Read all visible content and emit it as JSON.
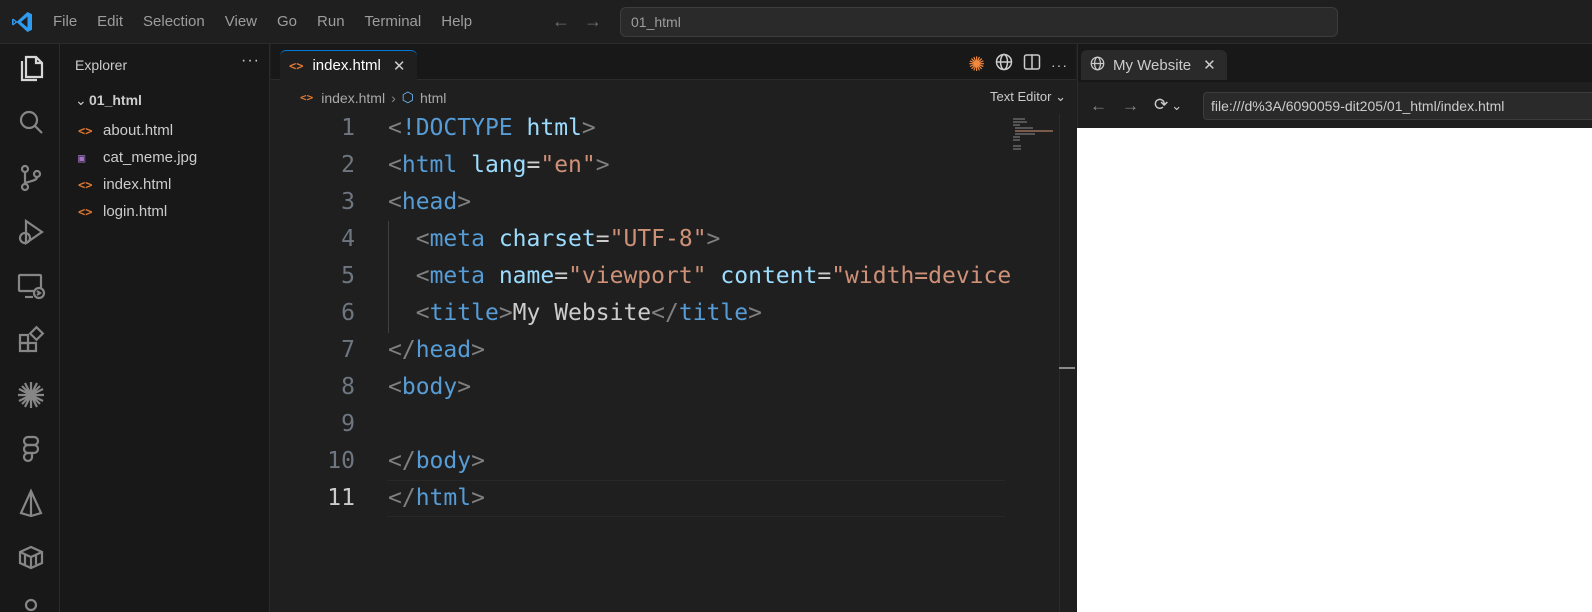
{
  "menu": [
    "File",
    "Edit",
    "Selection",
    "View",
    "Go",
    "Run",
    "Terminal",
    "Help"
  ],
  "command_center": "01_html",
  "activity_icons": [
    "explorer-icon",
    "search-icon",
    "source-control-icon",
    "run-debug-icon",
    "remote-explorer-icon",
    "extensions-icon",
    "sparkle-icon",
    "figma-icon",
    "prism-icon",
    "container-icon"
  ],
  "sidebar": {
    "title": "Explorer",
    "more": "···",
    "folder": "01_html",
    "files": [
      {
        "name": "about.html",
        "type": "html"
      },
      {
        "name": "cat_meme.jpg",
        "type": "image"
      },
      {
        "name": "index.html",
        "type": "html"
      },
      {
        "name": "login.html",
        "type": "html"
      }
    ]
  },
  "editor": {
    "tab_label": "index.html",
    "breadcrumb_file": "index.html",
    "breadcrumb_symbol": "html",
    "mode_label": "Text Editor",
    "current_line": 11,
    "lines": [
      [
        {
          "t": "br",
          "v": "<"
        },
        {
          "t": "tag",
          "v": "!DOCTYPE"
        },
        {
          "t": "txt",
          "v": " "
        },
        {
          "t": "attr",
          "v": "html"
        },
        {
          "t": "br",
          "v": ">"
        }
      ],
      [
        {
          "t": "br",
          "v": "<"
        },
        {
          "t": "tag",
          "v": "html"
        },
        {
          "t": "txt",
          "v": " "
        },
        {
          "t": "attr",
          "v": "lang"
        },
        {
          "t": "txt",
          "v": "="
        },
        {
          "t": "str",
          "v": "\"en\""
        },
        {
          "t": "br",
          "v": ">"
        }
      ],
      [
        {
          "t": "br",
          "v": "<"
        },
        {
          "t": "tag",
          "v": "head"
        },
        {
          "t": "br",
          "v": ">"
        }
      ],
      [
        {
          "t": "txt",
          "v": "  "
        },
        {
          "t": "br",
          "v": "<"
        },
        {
          "t": "tag",
          "v": "meta"
        },
        {
          "t": "txt",
          "v": " "
        },
        {
          "t": "attr",
          "v": "charset"
        },
        {
          "t": "txt",
          "v": "="
        },
        {
          "t": "str",
          "v": "\"UTF-8\""
        },
        {
          "t": "br",
          "v": ">"
        }
      ],
      [
        {
          "t": "txt",
          "v": "  "
        },
        {
          "t": "br",
          "v": "<"
        },
        {
          "t": "tag",
          "v": "meta"
        },
        {
          "t": "txt",
          "v": " "
        },
        {
          "t": "attr",
          "v": "name"
        },
        {
          "t": "txt",
          "v": "="
        },
        {
          "t": "str",
          "v": "\"viewport\""
        },
        {
          "t": "txt",
          "v": " "
        },
        {
          "t": "attr",
          "v": "content"
        },
        {
          "t": "txt",
          "v": "="
        },
        {
          "t": "str",
          "v": "\"width=device"
        }
      ],
      [
        {
          "t": "txt",
          "v": "  "
        },
        {
          "t": "br",
          "v": "<"
        },
        {
          "t": "tag",
          "v": "title"
        },
        {
          "t": "br",
          "v": ">"
        },
        {
          "t": "txt",
          "v": "My Website"
        },
        {
          "t": "br",
          "v": "</"
        },
        {
          "t": "tag",
          "v": "title"
        },
        {
          "t": "br",
          "v": ">"
        }
      ],
      [
        {
          "t": "br",
          "v": "</"
        },
        {
          "t": "tag",
          "v": "head"
        },
        {
          "t": "br",
          "v": ">"
        }
      ],
      [
        {
          "t": "br",
          "v": "<"
        },
        {
          "t": "tag",
          "v": "body"
        },
        {
          "t": "br",
          "v": ">"
        }
      ],
      [],
      [
        {
          "t": "br",
          "v": "</"
        },
        {
          "t": "tag",
          "v": "body"
        },
        {
          "t": "br",
          "v": ">"
        }
      ],
      [
        {
          "t": "br",
          "v": "</"
        },
        {
          "t": "tag",
          "v": "html"
        },
        {
          "t": "br",
          "v": ">"
        }
      ]
    ]
  },
  "browser": {
    "tab_label": "My Website",
    "url": "file:///d%3A/6090059-dit205/01_html/index.html"
  },
  "colors": {
    "accent": "#0078d4",
    "html_file_icon": "#e37933",
    "image_file_icon": "#a074c4",
    "tag": "#569cd6",
    "attribute": "#9cdcfe",
    "string": "#ce9178"
  }
}
